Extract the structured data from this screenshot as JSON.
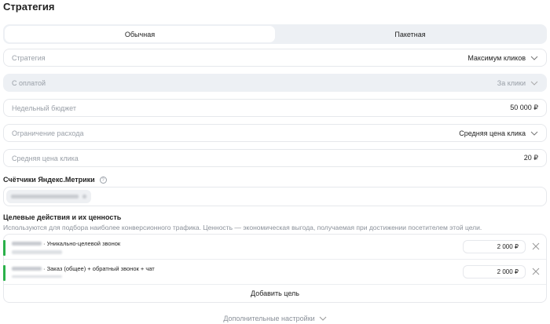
{
  "title": "Стратегия",
  "tabs": [
    {
      "label": "Обычная",
      "active": true
    },
    {
      "label": "Пакетная",
      "active": false
    }
  ],
  "fields": {
    "strategy": {
      "label": "Стратегия",
      "value": "Максимум кликов"
    },
    "payment": {
      "label": "С оплатой",
      "value": "За клики"
    },
    "budget": {
      "label": "Недельный бюджет",
      "value": "50 000 ₽"
    },
    "limit": {
      "label": "Ограничение расхода",
      "value": "Средняя цена клика"
    },
    "avg_cpc": {
      "label": "Средняя цена клика",
      "value": "20 ₽"
    }
  },
  "counters": {
    "heading": "Счётчики Яндекс.Метрики",
    "help": "?"
  },
  "goals": {
    "heading": "Целевые действия и их ценность",
    "description": "Используются для подбора наиболее конверсионного трафика. Ценность — экономическая выгода, получаемая при достижении посетителем этой цели.",
    "items": [
      {
        "name": "· Уникально-целевой звонок",
        "value": "2 000 ₽"
      },
      {
        "name": "· Заказ (общее) + обратный звонок + чат",
        "value": "2 000 ₽"
      }
    ],
    "add_label": "Добавить цель"
  },
  "more_settings": "Дополнительные настройки",
  "colors": {
    "accent": "#2bb14a",
    "muted": "#9aa0a8"
  }
}
